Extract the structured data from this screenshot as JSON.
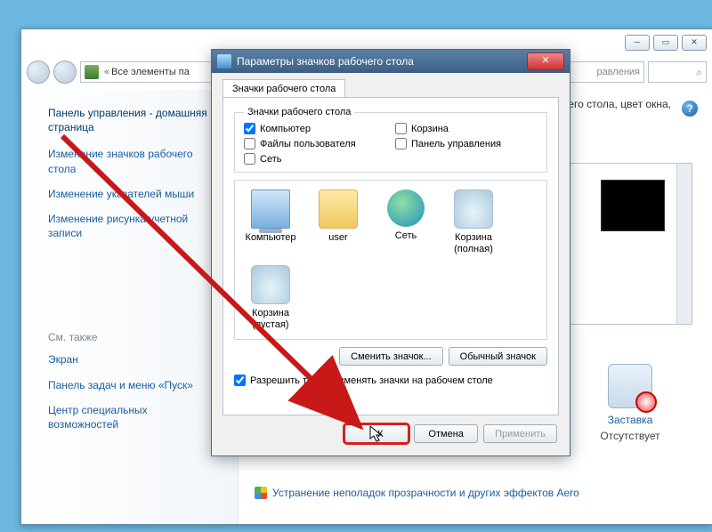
{
  "parent": {
    "breadcrumb_prefix": "Все элементы па",
    "breadcrumb_suffix": "равления",
    "search_placeholder": "⌕",
    "sidebar": {
      "heading": "Панель управления - домашняя страница",
      "links": [
        "Изменение значков рабочего стола",
        "Изменение указателей мыши",
        "Изменение рисунка учетной записи"
      ],
      "see_also_label": "См. также",
      "see_also": [
        "Экран",
        "Панель задач и меню «Пуск»",
        "Центр специальных возможностей"
      ]
    },
    "content_desc": "очего стола, цвет окна,",
    "screensaver": {
      "label": "Заставка",
      "status": "Отсутствует"
    },
    "aero_link": "Устранение неполадок прозрачности и других эффектов Aero"
  },
  "dialog": {
    "title": "Параметры значков рабочего стола",
    "tab_label": "Значки рабочего стола",
    "group_label": "Значки рабочего стола",
    "checks": {
      "computer": {
        "label": "Компьютер",
        "checked": true
      },
      "recycle": {
        "label": "Корзина",
        "checked": false
      },
      "userfiles": {
        "label": "Файлы пользователя",
        "checked": false
      },
      "cpanel": {
        "label": "Панель управления",
        "checked": false
      },
      "network": {
        "label": "Сеть",
        "checked": false
      }
    },
    "icons": [
      {
        "id": "computer",
        "label": "Компьютер"
      },
      {
        "id": "user",
        "label": "user"
      },
      {
        "id": "net",
        "label": "Сеть"
      },
      {
        "id": "bin-full",
        "label": "Корзина (полная)"
      },
      {
        "id": "bin-empty",
        "label": "Корзина (пустая)"
      }
    ],
    "change_icon": "Сменить значок...",
    "default_icon": "Обычный значок",
    "allow_themes": {
      "label": "Разрешить темам изменять значки на рабочем столе",
      "checked": true
    },
    "ok": "ОК",
    "cancel": "Отмена",
    "apply": "Применить"
  }
}
